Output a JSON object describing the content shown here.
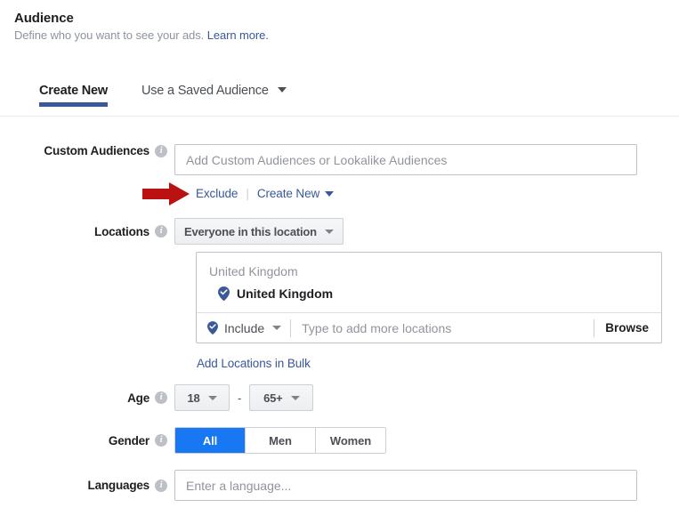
{
  "header": {
    "title": "Audience",
    "subtitle": "Define who you want to see your ads.",
    "learn_more": "Learn more."
  },
  "tabs": [
    {
      "label": "Create New",
      "active": true
    },
    {
      "label": "Use a Saved Audience",
      "active": false,
      "has_caret": true
    }
  ],
  "form": {
    "custom_audiences": {
      "label": "Custom Audiences",
      "placeholder": "Add Custom Audiences or Lookalike Audiences",
      "value": "",
      "exclude_link": "Exclude",
      "create_new_link": "Create New"
    },
    "locations": {
      "label": "Locations",
      "scope_button": "Everyone in this location",
      "group_header": "United Kingdom",
      "selected_item": "United Kingdom",
      "include_dropdown": "Include",
      "search_placeholder": "Type to add more locations",
      "search_value": "",
      "browse_button": "Browse",
      "bulk_link": "Add Locations in Bulk"
    },
    "age": {
      "label": "Age",
      "min": "18",
      "max": "65+",
      "separator": "-"
    },
    "gender": {
      "label": "Gender",
      "options": [
        "All",
        "Men",
        "Women"
      ],
      "selected": "All"
    },
    "languages": {
      "label": "Languages",
      "placeholder": "Enter a language...",
      "value": ""
    }
  },
  "annotation": {
    "arrow_color": "#bb1111",
    "points_to": "Exclude"
  },
  "colors": {
    "accent_blue": "#1877f2",
    "link_blue": "#385898",
    "tab_underline": "#3b5998",
    "pin_blue": "#3b5998"
  }
}
